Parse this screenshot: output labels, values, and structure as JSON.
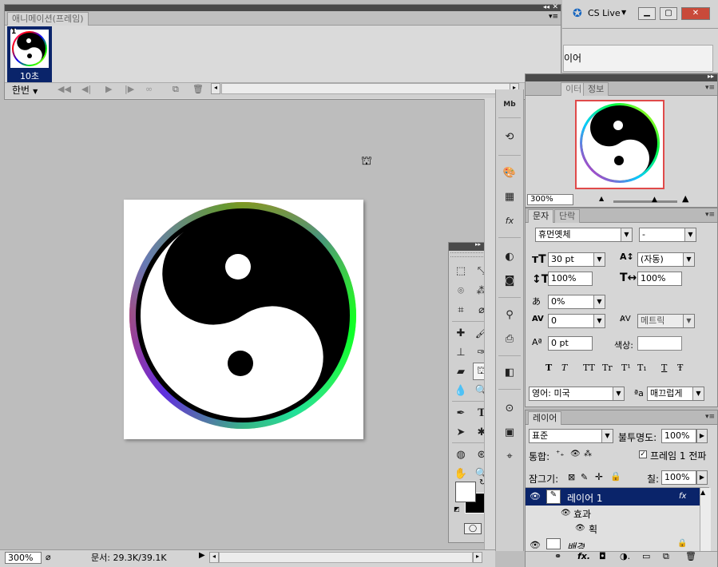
{
  "animation_panel": {
    "title": "애니메이션(프레임)",
    "frame_number": "1",
    "frame_delay": "10초",
    "loop": "한번"
  },
  "app": {
    "cs_live": "CS Live"
  },
  "top_right": {
    "partial_text": "이어"
  },
  "navigator": {
    "tab_navigator": "이터",
    "tab_info": "정보",
    "zoom": "300%"
  },
  "character": {
    "tab_char": "문자",
    "tab_para": "단락",
    "font_family": "휴먼옛체",
    "font_style": "-",
    "font_size": "30 pt",
    "leading": "(자동)",
    "v_scale": "100%",
    "h_scale": "100%",
    "tracking_ratio": "0%",
    "kerning": "0",
    "tracking": "메트릭",
    "baseline": "0 pt",
    "color_label": "색상:",
    "style_buttons": [
      "T",
      "T",
      "TT",
      "Tr",
      "T¹",
      "T₁",
      "T",
      "Ŧ"
    ],
    "language": "영어: 미국",
    "aa_icon": "ªa",
    "antialias": "매끄럽게"
  },
  "layers": {
    "tab": "레이어",
    "blend_mode": "표준",
    "opacity_label": "불투명도:",
    "opacity": "100%",
    "unify_label": "통합:",
    "propagate": "프레임 1 전파",
    "lock_label": "잠그기:",
    "fill_label": "칠:",
    "fill": "100%",
    "layer_name": "레이어 1",
    "effects": "효과",
    "stroke": "획",
    "next_layer": "배경"
  },
  "status": {
    "zoom": "300%",
    "doc_size": "문서: 29.3K/39.1K"
  },
  "colors": {
    "selected": "#0a246a",
    "stroke_red": "#e04a4a"
  }
}
